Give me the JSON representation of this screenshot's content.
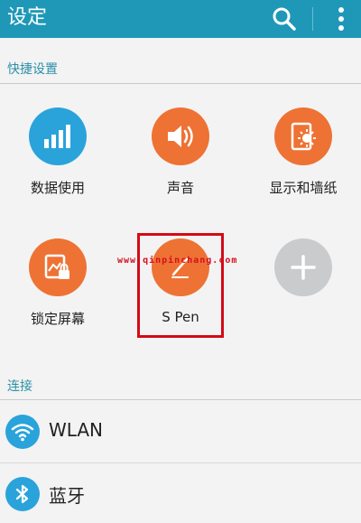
{
  "header": {
    "title": "设定",
    "search_icon": "search-icon",
    "more_icon": "more-vertical-icon"
  },
  "quick_settings": {
    "heading": "快捷设置",
    "tiles": [
      {
        "label": "数据使用",
        "icon": "bar-chart-icon",
        "color": "#2aa3db"
      },
      {
        "label": "声音",
        "icon": "speaker-icon",
        "color": "#ee7234"
      },
      {
        "label": "显示和墙纸",
        "icon": "display-wallpaper-icon",
        "color": "#ee7234"
      },
      {
        "label": "锁定屏幕",
        "icon": "lock-screen-icon",
        "color": "#ee7234"
      },
      {
        "label": "S Pen",
        "icon": "pen-icon",
        "color": "#ee7234"
      },
      {
        "label": "",
        "icon": "plus-icon",
        "color": "#c9cbcd"
      }
    ]
  },
  "overlay": {
    "watermark": "www.qinpinchang.com"
  },
  "connections": {
    "heading": "连接",
    "items": [
      {
        "label": "WLAN",
        "icon": "wifi-icon"
      },
      {
        "label": "蓝牙",
        "icon": "bluetooth-icon"
      }
    ]
  }
}
